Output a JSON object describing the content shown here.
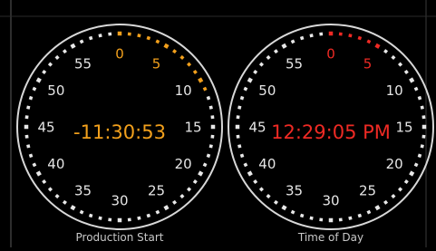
{
  "colors": {
    "background": "#000000",
    "ring": "#d8d8d8",
    "dot_inactive": "#e8e8e8",
    "number": "#e6e6e6",
    "caption": "#c8c8c8",
    "frame_line": "#6a6a6a"
  },
  "clocks": [
    {
      "id": "production-start",
      "caption": "Production Start",
      "readout": "-11:30:53",
      "accent": "#f2a01c",
      "highlight_numbers": [
        "0",
        "5"
      ],
      "numbers": [
        "0",
        "5",
        "10",
        "15",
        "20",
        "25",
        "30",
        "35",
        "40",
        "45",
        "50",
        "55"
      ],
      "seconds_elapsed": 11
    },
    {
      "id": "time-of-day",
      "caption": "Time of Day",
      "readout": "12:29:05 PM",
      "accent": "#ee2a24",
      "highlight_numbers": [
        "0",
        "5"
      ],
      "numbers": [
        "0",
        "5",
        "10",
        "15",
        "20",
        "25",
        "30",
        "35",
        "40",
        "45",
        "50",
        "55"
      ],
      "seconds_elapsed": 5
    }
  ]
}
